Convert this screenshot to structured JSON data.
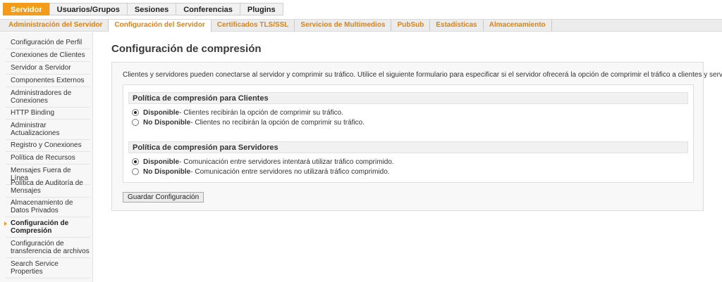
{
  "top_tabs": [
    {
      "label": "Servidor",
      "active": true
    },
    {
      "label": "Usuarios/Grupos",
      "active": false
    },
    {
      "label": "Sesiones",
      "active": false
    },
    {
      "label": "Conferencias",
      "active": false
    },
    {
      "label": "Plugins",
      "active": false
    }
  ],
  "sub_tabs": [
    {
      "label": "Administración del Servidor",
      "active": false
    },
    {
      "label": "Configuración del Servidor",
      "active": true
    },
    {
      "label": "Certificados TLS/SSL",
      "active": false
    },
    {
      "label": "Servicios de Multimedios",
      "active": false
    },
    {
      "label": "PubSub",
      "active": false
    },
    {
      "label": "Estadísticas",
      "active": false
    },
    {
      "label": "Almacenamiento",
      "active": false
    }
  ],
  "sidebar": {
    "items": [
      {
        "label": "Configuración de Perfil"
      },
      {
        "label": "Conexiones de Clientes"
      },
      {
        "label": "Servidor a Servidor"
      },
      {
        "label": "Componentes Externos"
      },
      {
        "label": "Administradores de Conexiones"
      },
      {
        "label": "HTTP Binding"
      },
      {
        "label": "Administrar Actualizaciones"
      },
      {
        "label": "Registro y Conexiones"
      },
      {
        "label": "Política de Recursos"
      },
      {
        "label": "Mensajes Fuera de Línea"
      },
      {
        "label": "Política de Auditoría de Mensajes"
      },
      {
        "label": "Almacenamiento de Datos Privados"
      },
      {
        "label": "Configuración de Compresión",
        "active": true
      },
      {
        "label": "Configuración de transferencia de archivos"
      },
      {
        "label": "Search Service Properties"
      }
    ]
  },
  "main": {
    "title": "Configuración de compresión",
    "intro": "Clientes y servidores pueden conectarse al servidor y comprimir su tráfico. Utilice el siguiente formulario para especificar si el servidor ofrecerá la opción de comprimir el tráfico a clientes y servidores.",
    "clients": {
      "heading": "Política de compresión para Clientes",
      "options": [
        {
          "label": "Disponible",
          "desc": " - Clientes recibirán la opción de comprimir su tráfico.",
          "selected": true
        },
        {
          "label": "No Disponible",
          "desc": " - Clientes no recibirán la opción de comprimir su tráfico.",
          "selected": false
        }
      ]
    },
    "servers": {
      "heading": "Política de compresión para Servidores",
      "options": [
        {
          "label": "Disponible",
          "desc": " - Comunicación entre servidores intentará utilizar tráfico comprimido.",
          "selected": true
        },
        {
          "label": "No Disponible",
          "desc": " - Comunicación entre servidores no utilizará tráfico comprimido.",
          "selected": false
        }
      ]
    },
    "save_label": "Guardar Configuración"
  },
  "colors": {
    "accent": "#f49b1a",
    "subtab_text": "#e3810a"
  }
}
